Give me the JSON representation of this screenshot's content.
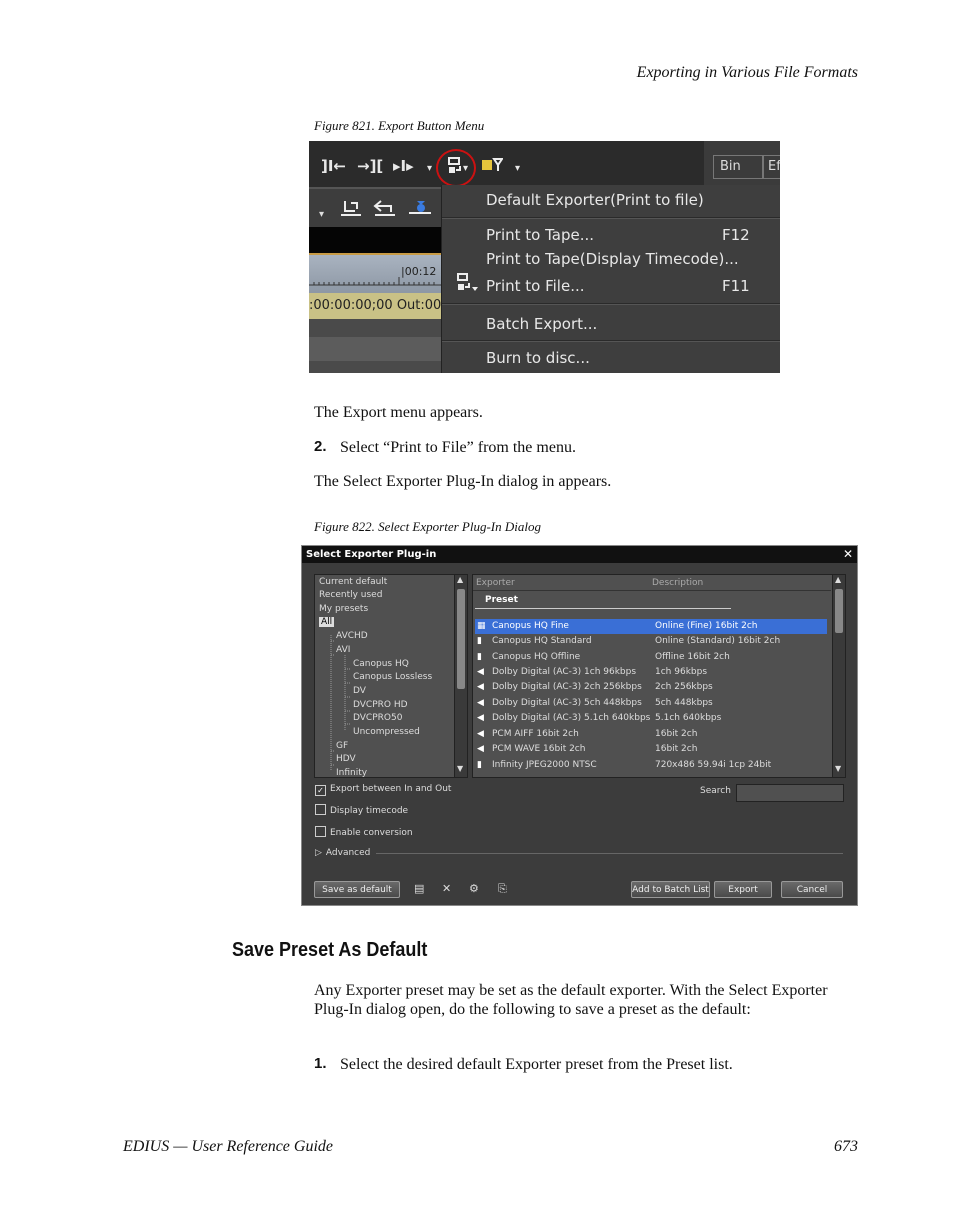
{
  "header": {
    "title": "Exporting in Various File Formats"
  },
  "figure821": {
    "caption": "Figure 821.  Export Button Menu",
    "toolbar_icons": [
      "]I←",
      "→][",
      "▸I▸",
      "▾",
      "▾",
      "▾"
    ],
    "bin_tab": "Bin",
    "effect_tab": "Ef",
    "ruler_label": "|00:12",
    "timecode": ":00:00:00;00 Out:00",
    "menu": {
      "items": [
        {
          "label": "Default Exporter(Print to file)",
          "shortcut": ""
        },
        {
          "label": "Print to Tape...",
          "shortcut": "F12"
        },
        {
          "label": "Print to Tape(Display Timecode)...",
          "shortcut": ""
        },
        {
          "label": "Print to File...",
          "shortcut": "F11"
        },
        {
          "label": "Batch Export...",
          "shortcut": ""
        },
        {
          "label": "Burn to disc...",
          "shortcut": ""
        }
      ]
    }
  },
  "body": {
    "p1": "The Export menu appears.",
    "step2_num": "2.",
    "step2_text": "Select “Print to File” from the menu.",
    "p2": "The Select Exporter Plug-In dialog in appears."
  },
  "figure822": {
    "caption": "Figure 822.  Select Exporter Plug-In Dialog",
    "title": "Select Exporter Plug-in",
    "close": "✕",
    "tree": [
      {
        "label": "Current default",
        "indent": 0
      },
      {
        "label": "Recently used",
        "indent": 0
      },
      {
        "label": "My presets",
        "indent": 0
      },
      {
        "label": "All",
        "indent": 0,
        "selected": true
      },
      {
        "label": "AVCHD",
        "indent": 1
      },
      {
        "label": "AVI",
        "indent": 1
      },
      {
        "label": "Canopus HQ",
        "indent": 2
      },
      {
        "label": "Canopus Lossless",
        "indent": 2
      },
      {
        "label": "DV",
        "indent": 2
      },
      {
        "label": "DVCPRO HD",
        "indent": 2
      },
      {
        "label": "DVCPRO50",
        "indent": 2
      },
      {
        "label": "Uncompressed",
        "indent": 2
      },
      {
        "label": "GF",
        "indent": 1
      },
      {
        "label": "HDV",
        "indent": 1
      },
      {
        "label": "Infinity",
        "indent": 1
      }
    ],
    "columns": {
      "exporter": "Exporter",
      "description": "Description"
    },
    "preset_tab": "Preset",
    "rows": [
      {
        "name": "Canopus HQ Fine",
        "desc": "Online (Fine) 16bit 2ch",
        "icon": "film"
      },
      {
        "name": "Canopus HQ Standard",
        "desc": "Online (Standard) 16bit 2ch",
        "icon": "film"
      },
      {
        "name": "Canopus HQ Offline",
        "desc": "Offline 16bit 2ch",
        "icon": "film"
      },
      {
        "name": "Dolby Digital (AC-3) 1ch 96kbps",
        "desc": "1ch 96kbps",
        "icon": "audio"
      },
      {
        "name": "Dolby Digital (AC-3) 2ch 256kbps",
        "desc": "2ch 256kbps",
        "icon": "audio"
      },
      {
        "name": "Dolby Digital (AC-3) 5ch 448kbps",
        "desc": "5ch 448kbps",
        "icon": "audio"
      },
      {
        "name": "Dolby Digital (AC-3) 5.1ch 640kbps",
        "desc": "5.1ch 640kbps",
        "icon": "audio"
      },
      {
        "name": "PCM AIFF 16bit 2ch",
        "desc": "16bit 2ch",
        "icon": "audio"
      },
      {
        "name": "PCM WAVE 16bit 2ch",
        "desc": "16bit 2ch",
        "icon": "audio"
      },
      {
        "name": "Infinity JPEG2000 NTSC",
        "desc": "720x486 59.94i 1cp 24bit",
        "icon": "film"
      }
    ],
    "options": {
      "export_between": "Export between In and Out",
      "display_timecode": "Display timecode",
      "enable_conversion": "Enable conversion",
      "advanced": "Advanced",
      "search_label": "Search",
      "search_value": ""
    },
    "buttons": {
      "save_default": "Save as default",
      "add_batch": "Add to Batch List",
      "export": "Export",
      "cancel": "Cancel"
    }
  },
  "section": {
    "heading": "Save Preset As Default",
    "para": "Any Exporter preset may be set as the default exporter. With the Select Exporter Plug-In dialog open, do the following to save a preset as the default:",
    "step1_num": "1.",
    "step1_text": "Select the desired default Exporter preset from the Preset list."
  },
  "footer": {
    "left": "EDIUS  —  User Reference Guide",
    "page": "673"
  },
  "colors": {
    "dialog_selection": "#3a6fd6",
    "highlight_circle": "#cc1111"
  }
}
